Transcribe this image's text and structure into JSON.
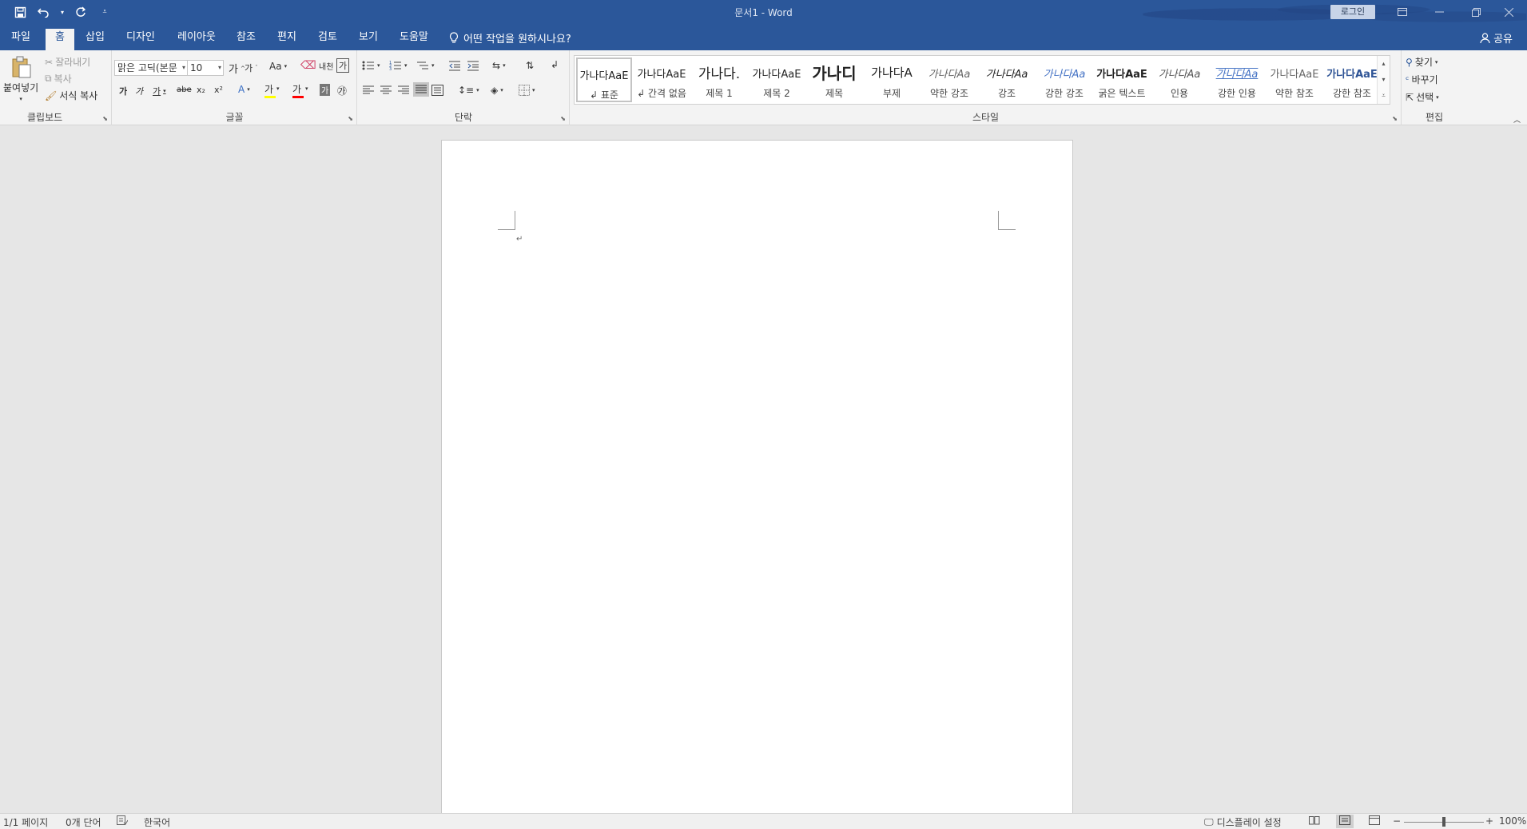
{
  "window": {
    "title": "문서1  -  Word",
    "login_label": "로그인",
    "controls": [
      "ribbon-display-icon",
      "minimize-icon",
      "restore-icon",
      "close-icon"
    ]
  },
  "qat": {
    "save": "save-icon",
    "undo": "undo-icon",
    "redo": "redo-icon",
    "customize": "customize-qat-icon"
  },
  "tabs": [
    "파일",
    "홈",
    "삽입",
    "디자인",
    "레이아웃",
    "참조",
    "편지",
    "검토",
    "보기",
    "도움말"
  ],
  "active_tab": "홈",
  "tellme": "어떤 작업을 원하시나요?",
  "share": "공유",
  "clipboard": {
    "label": "클립보드",
    "paste": "붙여넣기",
    "cut": "잘라내기",
    "copy": "복사",
    "format_painter": "서식 복사"
  },
  "font": {
    "label": "글꼴",
    "font_name": "맑은 고딕(본문",
    "font_size": "10",
    "change_case": "Aa",
    "phonetic": "내천",
    "bold": "가",
    "italic": "가",
    "underline": "가",
    "strike": "abe",
    "subscript": "x₂",
    "superscript": "x²",
    "highlight": "가",
    "font_color": "가",
    "enclose": "㉮",
    "grow": "가",
    "shrink": "가",
    "border": "가"
  },
  "paragraph": {
    "label": "단락"
  },
  "styles": {
    "label": "스타일",
    "items": [
      {
        "sample": "가나다AaE",
        "name": "↲ 표준"
      },
      {
        "sample": "가나다AaE",
        "name": "↲ 간격 없음"
      },
      {
        "sample": "가나다.",
        "name": "제목 1"
      },
      {
        "sample": "가나다AaE",
        "name": "제목 2"
      },
      {
        "sample": "가나디",
        "name": "제목"
      },
      {
        "sample": "가나다A",
        "name": "부제"
      },
      {
        "sample": "가나다Aa",
        "name": "약한 강조"
      },
      {
        "sample": "가나다Aa",
        "name": "강조"
      },
      {
        "sample": "가나다Aa",
        "name": "강한 강조"
      },
      {
        "sample": "가나다AaE",
        "name": "굵은 텍스트"
      },
      {
        "sample": "가나다Aa",
        "name": "인용"
      },
      {
        "sample": "가나다Aa",
        "name": "강한 인용"
      },
      {
        "sample": "가나다AaE",
        "name": "약한 참조"
      },
      {
        "sample": "가나다AaE",
        "name": "강한 참조"
      }
    ]
  },
  "editing": {
    "label": "편집",
    "find": "찾기",
    "replace": "바꾸기",
    "select": "선택"
  },
  "status": {
    "page": "1/1 페이지",
    "words": "0개 단어",
    "language": "한국어",
    "display_settings": "디스플레이 설정",
    "zoom": "100%",
    "zoom_minus": "−",
    "zoom_plus": "+"
  },
  "colors": {
    "accent": "#2b579a",
    "highlight_bar": "#ffff00",
    "font_color_bar": "#ff0000",
    "heading_blue": "#2f5496"
  },
  "document": {
    "paragraph_mark": "↵"
  }
}
